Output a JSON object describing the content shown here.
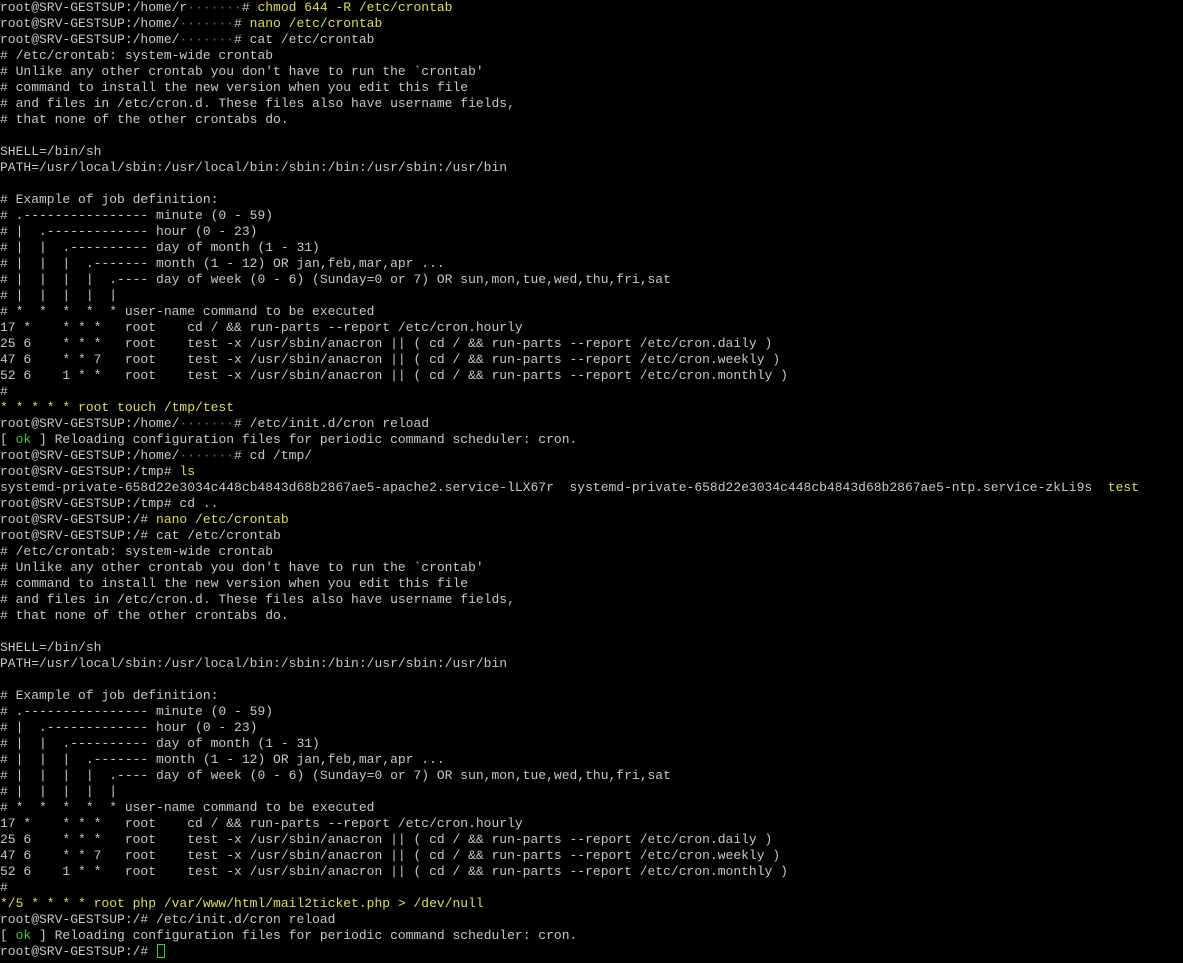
{
  "terminal": {
    "colors": {
      "background": "#000000",
      "text": "#c8c8c8",
      "command": "#dede5a",
      "ok": "#4ec04e",
      "cursor": "#39d239"
    },
    "lines": [
      [
        {
          "t": "root@SRV-GESTSUP:/home/r",
          "c": "default"
        },
        {
          "t": "·······",
          "c": "blur"
        },
        {
          "t": "# ",
          "c": "default"
        },
        {
          "t": "chmod 644 -R /etc/crontab",
          "c": "yellow"
        }
      ],
      [
        {
          "t": "root@SRV-GESTSUP:/home/",
          "c": "default"
        },
        {
          "t": "·······",
          "c": "blur"
        },
        {
          "t": "# ",
          "c": "default"
        },
        {
          "t": "nano /etc/crontab",
          "c": "yellow"
        }
      ],
      [
        {
          "t": "root@SRV-GESTSUP:/home/",
          "c": "default"
        },
        {
          "t": "·······",
          "c": "blur"
        },
        {
          "t": "# cat /etc/crontab",
          "c": "default"
        }
      ],
      [
        {
          "t": "# /etc/crontab: system-wide crontab",
          "c": "default"
        }
      ],
      [
        {
          "t": "# Unlike any other crontab you don't have to run the `crontab'",
          "c": "default"
        }
      ],
      [
        {
          "t": "# command to install the new version when you edit this file",
          "c": "default"
        }
      ],
      [
        {
          "t": "# and files in /etc/cron.d. These files also have username fields,",
          "c": "default"
        }
      ],
      [
        {
          "t": "# that none of the other crontabs do.",
          "c": "default"
        }
      ],
      [
        {
          "t": "",
          "c": "default"
        }
      ],
      [
        {
          "t": "SHELL=/bin/sh",
          "c": "default"
        }
      ],
      [
        {
          "t": "PATH=/usr/local/sbin:/usr/local/bin:/sbin:/bin:/usr/sbin:/usr/bin",
          "c": "default"
        }
      ],
      [
        {
          "t": "",
          "c": "default"
        }
      ],
      [
        {
          "t": "# Example of job definition:",
          "c": "default"
        }
      ],
      [
        {
          "t": "# .---------------- minute (0 - 59)",
          "c": "default"
        }
      ],
      [
        {
          "t": "# |  .------------- hour (0 - 23)",
          "c": "default"
        }
      ],
      [
        {
          "t": "# |  |  .---------- day of month (1 - 31)",
          "c": "default"
        }
      ],
      [
        {
          "t": "# |  |  |  .------- month (1 - 12) OR jan,feb,mar,apr ...",
          "c": "default"
        }
      ],
      [
        {
          "t": "# |  |  |  |  .---- day of week (0 - 6) (Sunday=0 or 7) OR sun,mon,tue,wed,thu,fri,sat",
          "c": "default"
        }
      ],
      [
        {
          "t": "# |  |  |  |  |",
          "c": "default"
        }
      ],
      [
        {
          "t": "# *  *  *  *  * user-name command to be executed",
          "c": "default"
        }
      ],
      [
        {
          "t": "17 *    * * *   root    cd / && run-parts --report /etc/cron.hourly",
          "c": "default"
        }
      ],
      [
        {
          "t": "25 6    * * *   root    test -x /usr/sbin/anacron || ( cd / && run-parts --report /etc/cron.daily )",
          "c": "default"
        }
      ],
      [
        {
          "t": "47 6    * * 7   root    test -x /usr/sbin/anacron || ( cd / && run-parts --report /etc/cron.weekly )",
          "c": "default"
        }
      ],
      [
        {
          "t": "52 6    1 * *   root    test -x /usr/sbin/anacron || ( cd / && run-parts --report /etc/cron.monthly )",
          "c": "default"
        }
      ],
      [
        {
          "t": "#",
          "c": "default"
        }
      ],
      [
        {
          "t": "* * * * * root touch /tmp/test",
          "c": "yellow"
        }
      ],
      [
        {
          "t": "root@SRV-GESTSUP:/home/",
          "c": "default"
        },
        {
          "t": "·······",
          "c": "blur"
        },
        {
          "t": "# /etc/init.d/cron reload",
          "c": "default"
        }
      ],
      [
        {
          "t": "[ ",
          "c": "default"
        },
        {
          "t": "ok",
          "c": "green"
        },
        {
          "t": " ] Reloading configuration files for periodic command scheduler: cron.",
          "c": "default"
        }
      ],
      [
        {
          "t": "root@SRV-GESTSUP:/home/",
          "c": "default"
        },
        {
          "t": "·······",
          "c": "blur"
        },
        {
          "t": "# cd /tmp/",
          "c": "default"
        }
      ],
      [
        {
          "t": "root@SRV-GESTSUP:/tmp# ",
          "c": "default"
        },
        {
          "t": "ls",
          "c": "yellow"
        }
      ],
      [
        {
          "t": "systemd-private-658d22e3034c448cb4843d68b2867ae5-apache2.service-lLX67r  systemd-private-658d22e3034c448cb4843d68b2867ae5-ntp.service-zkLi9s  ",
          "c": "default"
        },
        {
          "t": "test",
          "c": "yellow"
        }
      ],
      [
        {
          "t": "root@SRV-GESTSUP:/tmp# cd ..",
          "c": "default"
        }
      ],
      [
        {
          "t": "root@SRV-GESTSUP:/# ",
          "c": "default"
        },
        {
          "t": "nano /etc/crontab",
          "c": "yellow"
        }
      ],
      [
        {
          "t": "root@SRV-GESTSUP:/# cat /etc/crontab",
          "c": "default"
        }
      ],
      [
        {
          "t": "# /etc/crontab: system-wide crontab",
          "c": "default"
        }
      ],
      [
        {
          "t": "# Unlike any other crontab you don't have to run the `crontab'",
          "c": "default"
        }
      ],
      [
        {
          "t": "# command to install the new version when you edit this file",
          "c": "default"
        }
      ],
      [
        {
          "t": "# and files in /etc/cron.d. These files also have username fields,",
          "c": "default"
        }
      ],
      [
        {
          "t": "# that none of the other crontabs do.",
          "c": "default"
        }
      ],
      [
        {
          "t": "",
          "c": "default"
        }
      ],
      [
        {
          "t": "SHELL=/bin/sh",
          "c": "default"
        }
      ],
      [
        {
          "t": "PATH=/usr/local/sbin:/usr/local/bin:/sbin:/bin:/usr/sbin:/usr/bin",
          "c": "default"
        }
      ],
      [
        {
          "t": "",
          "c": "default"
        }
      ],
      [
        {
          "t": "# Example of job definition:",
          "c": "default"
        }
      ],
      [
        {
          "t": "# .---------------- minute (0 - 59)",
          "c": "default"
        }
      ],
      [
        {
          "t": "# |  .------------- hour (0 - 23)",
          "c": "default"
        }
      ],
      [
        {
          "t": "# |  |  .---------- day of month (1 - 31)",
          "c": "default"
        }
      ],
      [
        {
          "t": "# |  |  |  .------- month (1 - 12) OR jan,feb,mar,apr ...",
          "c": "default"
        }
      ],
      [
        {
          "t": "# |  |  |  |  .---- day of week (0 - 6) (Sunday=0 or 7) OR sun,mon,tue,wed,thu,fri,sat",
          "c": "default"
        }
      ],
      [
        {
          "t": "# |  |  |  |  |",
          "c": "default"
        }
      ],
      [
        {
          "t": "# *  *  *  *  * user-name command to be executed",
          "c": "default"
        }
      ],
      [
        {
          "t": "17 *    * * *   root    cd / && run-parts --report /etc/cron.hourly",
          "c": "default"
        }
      ],
      [
        {
          "t": "25 6    * * *   root    test -x /usr/sbin/anacron || ( cd / && run-parts --report /etc/cron.daily )",
          "c": "default"
        }
      ],
      [
        {
          "t": "47 6    * * 7   root    test -x /usr/sbin/anacron || ( cd / && run-parts --report /etc/cron.weekly )",
          "c": "default"
        }
      ],
      [
        {
          "t": "52 6    1 * *   root    test -x /usr/sbin/anacron || ( cd / && run-parts --report /etc/cron.monthly )",
          "c": "default"
        }
      ],
      [
        {
          "t": "#",
          "c": "default"
        }
      ],
      [
        {
          "t": "*/5 * * * * root php /var/www/html/mail2ticket.php > /dev/null",
          "c": "yellow"
        }
      ],
      [
        {
          "t": "root@SRV-GESTSUP:/# /etc/init.d/cron reload",
          "c": "default"
        }
      ],
      [
        {
          "t": "[ ",
          "c": "default"
        },
        {
          "t": "ok",
          "c": "green"
        },
        {
          "t": " ] Reloading configuration files for periodic command scheduler: cron.",
          "c": "default"
        }
      ]
    ],
    "prompt": "root@SRV-GESTSUP:/# "
  }
}
